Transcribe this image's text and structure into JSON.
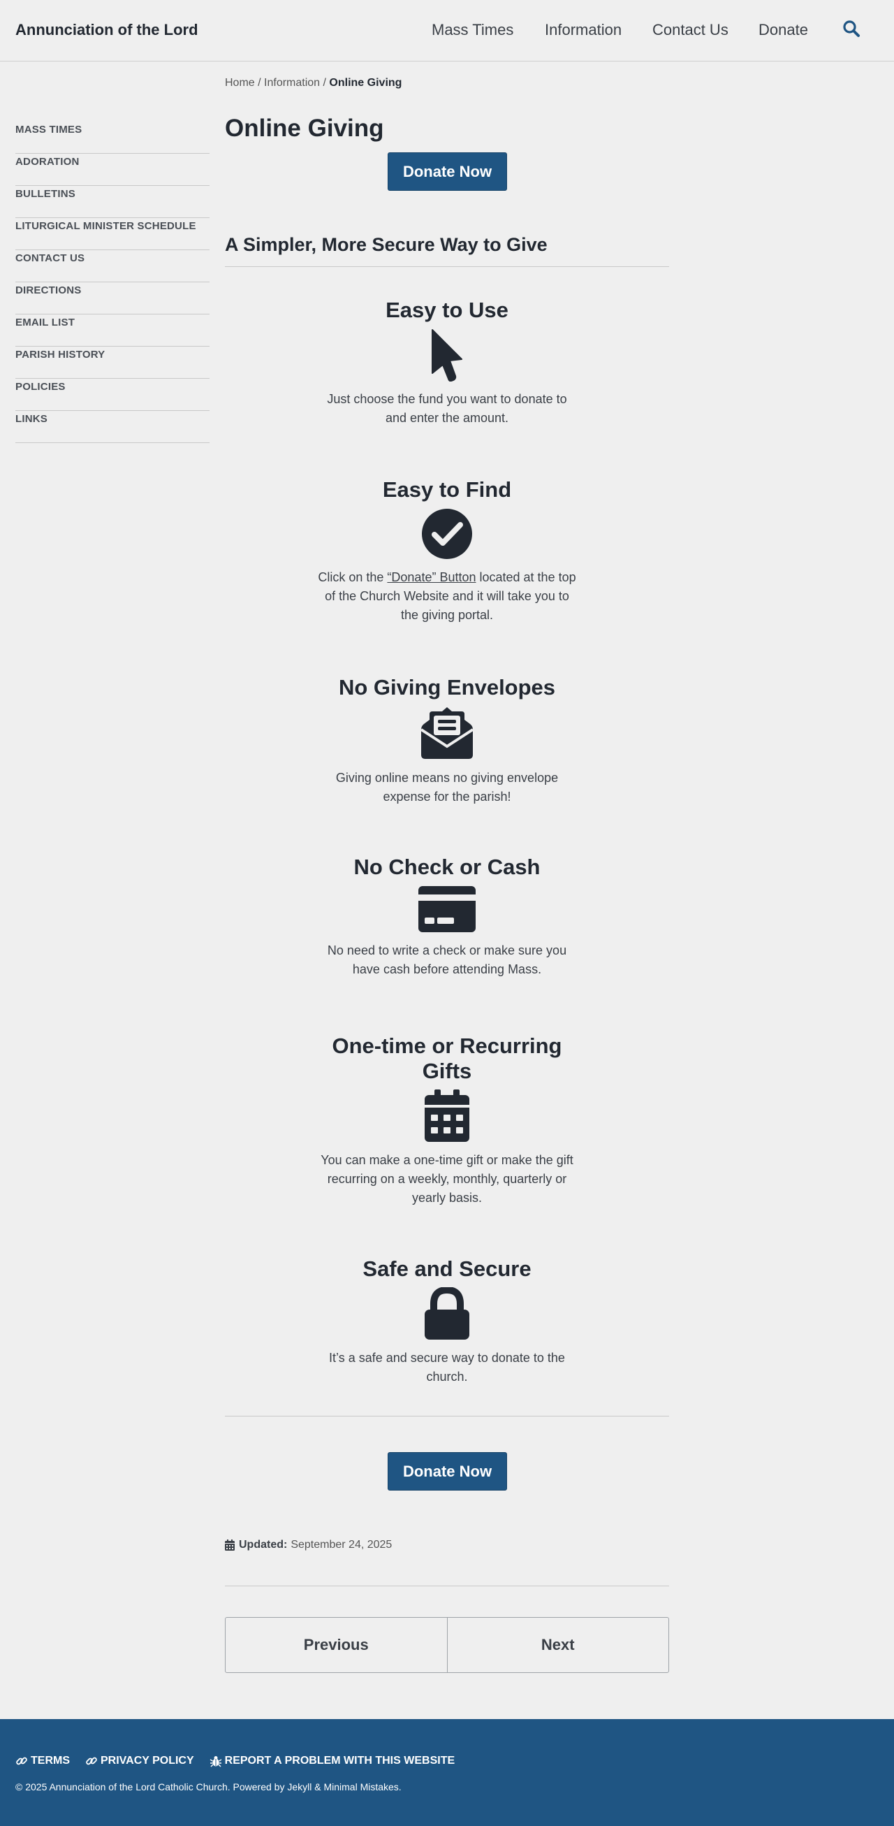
{
  "site": {
    "title": "Annunciation of the Lord"
  },
  "nav": {
    "items": [
      {
        "label": "Mass Times"
      },
      {
        "label": "Information"
      },
      {
        "label": "Contact Us"
      },
      {
        "label": "Donate"
      }
    ],
    "search_icon": "search-icon"
  },
  "breadcrumb": {
    "home": "Home",
    "sep1": " / ",
    "parent": "Information",
    "sep2": " / ",
    "current": "Online Giving"
  },
  "sidebar": {
    "items": [
      {
        "label": "MASS TIMES"
      },
      {
        "label": "ADORATION"
      },
      {
        "label": "BULLETINS"
      },
      {
        "label": "LITURGICAL MINISTER SCHEDULE"
      },
      {
        "label": "CONTACT US"
      },
      {
        "label": "DIRECTIONS"
      },
      {
        "label": "EMAIL LIST"
      },
      {
        "label": "PARISH HISTORY"
      },
      {
        "label": "POLICIES"
      },
      {
        "label": "LINKS"
      }
    ]
  },
  "main": {
    "title": "Online Giving",
    "donate_label": "Donate Now",
    "subtitle": "A Simpler, More Secure Way to Give",
    "features": [
      {
        "title": "Easy to Use",
        "icon": "pointer-icon",
        "text": "Just choose the fund you want to donate to and enter the amount."
      },
      {
        "title": "Easy to Find",
        "icon": "check-circle-icon",
        "text_before": "Click on the ",
        "link": "“Donate” Button",
        "text_after": " located at the top of the Church Website and it will take you to the giving portal."
      },
      {
        "title": "No Giving Envelopes",
        "icon": "envelope-open-icon",
        "text": "Giving online means no giving envelope expense for the parish!"
      },
      {
        "title": "No Check or Cash",
        "icon": "credit-card-icon",
        "text": "No need to write a check or make sure you have cash before attending Mass."
      },
      {
        "title": "One-time or Recurring Gifts",
        "icon": "calendar-icon",
        "text": "You can make a one-time gift or make the gift recurring on a weekly, monthly, quarterly or yearly basis."
      },
      {
        "title": "Safe and Secure",
        "icon": "lock-icon",
        "text": "It’s a safe and secure way to donate to the church."
      }
    ],
    "updated_label": "Updated:",
    "updated_date": "September 24, 2025",
    "pager": {
      "previous": "Previous",
      "next": "Next"
    }
  },
  "footer": {
    "links": [
      {
        "label": "TERMS",
        "icon": "link-icon"
      },
      {
        "label": "PRIVACY POLICY",
        "icon": "link-icon"
      },
      {
        "label": "REPORT A PROBLEM WITH THIS WEBSITE",
        "icon": "bug-icon"
      }
    ],
    "copyright": "© 2025 Annunciation of the Lord Catholic Church. Powered by Jekyll & Minimal Mistakes."
  },
  "colors": {
    "accent": "#1f5583",
    "text": "#222831",
    "background": "#efefef"
  }
}
